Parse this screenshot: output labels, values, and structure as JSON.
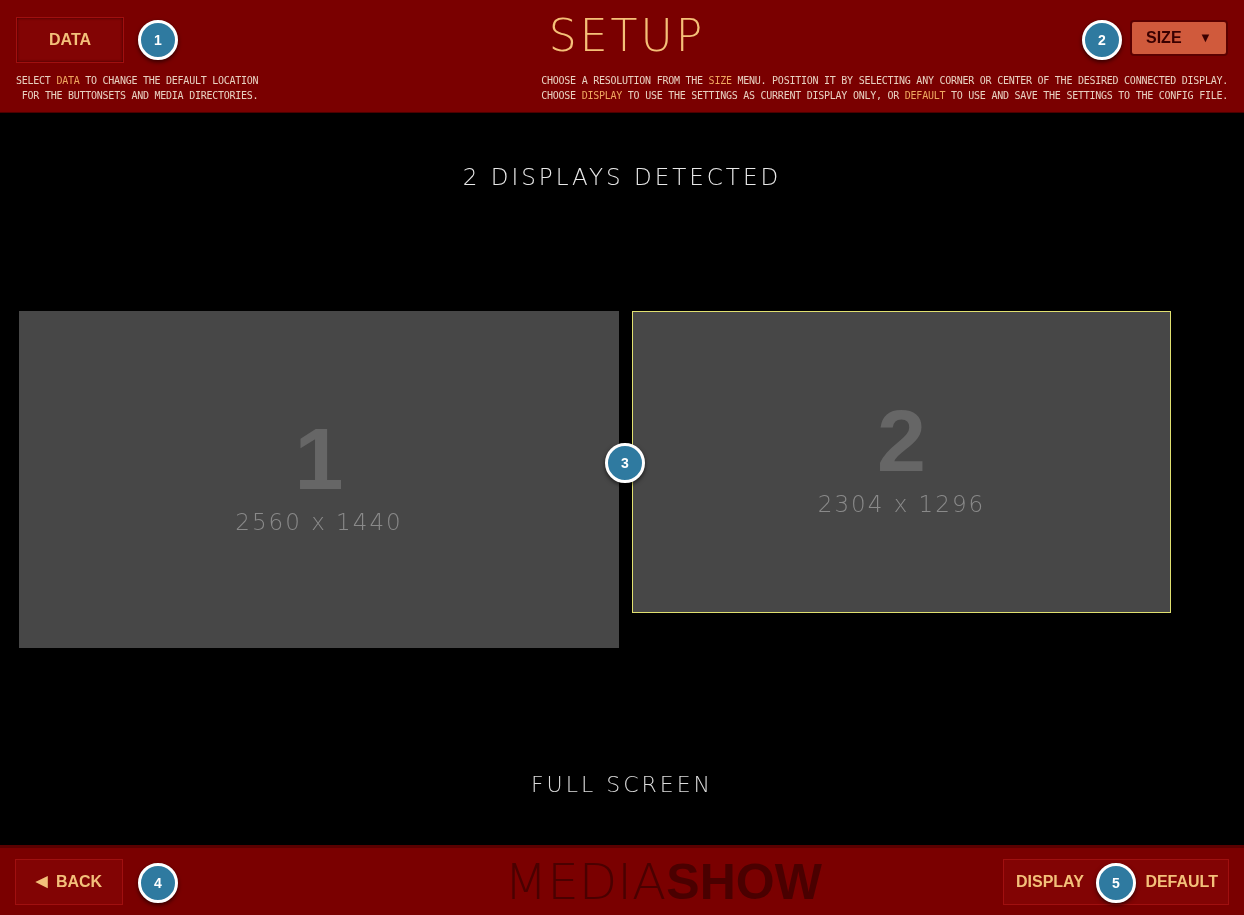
{
  "header": {
    "title": "SETUP",
    "data_button": "DATA",
    "size_button": "SIZE",
    "size_caret": "▼",
    "left_help": [
      [
        {
          "text": "SELECT ",
          "highlight": false
        },
        {
          "text": "DATA",
          "highlight": true
        },
        {
          "text": " TO CHANGE THE DEFAULT LOCATION",
          "highlight": false
        }
      ],
      [
        {
          "text": "FOR THE BUTTONSETS AND MEDIA DIRECTORIES.",
          "highlight": false
        }
      ]
    ],
    "right_help": [
      [
        {
          "text": "CHOOSE A RESOLUTION FROM THE ",
          "highlight": false
        },
        {
          "text": "SIZE",
          "highlight": true
        },
        {
          "text": " MENU. POSITION IT BY SELECTING ANY CORNER OR CENTER OF THE DESIRED CONNECTED DISPLAY.",
          "highlight": false
        }
      ],
      [
        {
          "text": "CHOOSE ",
          "highlight": false
        },
        {
          "text": "DISPLAY",
          "highlight": true
        },
        {
          "text": " TO USE THE SETTINGS AS CURRENT DISPLAY ONLY, OR ",
          "highlight": false
        },
        {
          "text": "DEFAULT",
          "highlight": true
        },
        {
          "text": " TO USE AND SAVE THE SETTINGS TO THE CONFIG FILE.",
          "highlight": false
        }
      ]
    ]
  },
  "heading": "2 DISPLAYS DETECTED",
  "displays": [
    {
      "number": "1",
      "resolution": "2560 x 1440",
      "selected": false
    },
    {
      "number": "2",
      "resolution": "2304 x 1296",
      "selected": true
    }
  ],
  "mode": "FULL SCREEN",
  "footer": {
    "back_caret": "◀",
    "back": "BACK",
    "logo_light": "MEDIA",
    "logo_bold": "SHOW",
    "display": "DISPLAY",
    "default": "DEFAULT"
  },
  "callouts": [
    "1",
    "2",
    "3",
    "4",
    "5"
  ]
}
